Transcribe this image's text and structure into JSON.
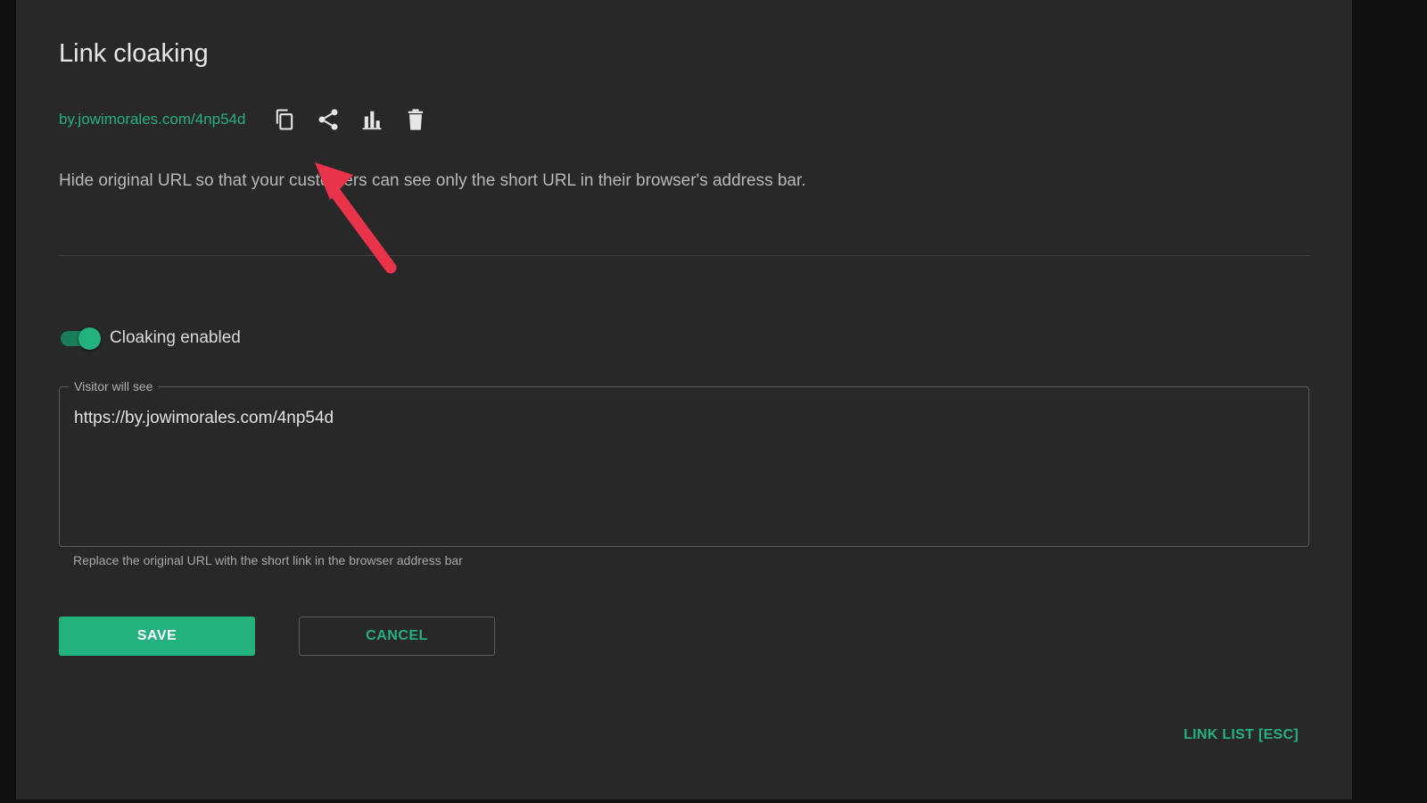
{
  "page": {
    "title": "Link cloaking",
    "short_link": "by.jowimorales.com/4np54d",
    "description": "Hide original URL so that your customers can see only the short URL in their browser's address bar."
  },
  "toolbar": {
    "icons": [
      "copy-icon",
      "share-icon",
      "stats-icon",
      "trash-icon"
    ]
  },
  "cloaking": {
    "enabled": true,
    "label": "Cloaking enabled"
  },
  "visitor_field": {
    "legend": "Visitor will see",
    "value": "https://by.jowimorales.com/4np54d",
    "helper": "Replace the original URL with the short link in the browser address bar"
  },
  "actions": {
    "save_label": "SAVE",
    "cancel_label": "CANCEL",
    "link_list_label": "LINK LIST [ESC]"
  },
  "colors": {
    "accent": "#23b17e",
    "panel": "#282828",
    "background": "#0f0f0f",
    "annotation_arrow": "#e8334a"
  }
}
